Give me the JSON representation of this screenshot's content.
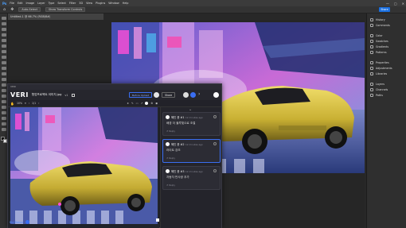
{
  "app": {
    "menus": [
      "File",
      "Edit",
      "Image",
      "Layer",
      "Type",
      "Select",
      "Filter",
      "3D",
      "View",
      "Plugins",
      "Window",
      "Help"
    ],
    "window_controls": [
      "—",
      "▢",
      "✕"
    ],
    "options_chip_1": "Auto-Select",
    "options_chip_2": "Show Transform Controls",
    "share_label": "Share",
    "doc_tab_title": "Untitled-1 @ 66.7% (RGB/8#)"
  },
  "dock": {
    "items": [
      "History",
      "Comments",
      "Color",
      "Swatches",
      "Gradients",
      "Patterns",
      "Properties",
      "Adjustments",
      "Libraries",
      "Layers",
      "Channels",
      "Paths"
    ]
  },
  "veri": {
    "window_title": "VERI",
    "logo": "VERI",
    "file_name": "협업프로젝트 이미지.jpg",
    "version": "v1",
    "before_button": "Before Upload",
    "share_button": "Share",
    "zoom": "10%",
    "page": "1/1",
    "big_button": "Big Bonus"
  },
  "comments": [
    {
      "name": "혜인 윤 #1",
      "time": "12 minutes ago",
      "text": "배경 더 블루빛으로 조절",
      "reply": "Reply"
    },
    {
      "name": "혜인 윤 #2",
      "time": "12 minutes ago",
      "text": "라이트 강조",
      "reply": "Reply"
    },
    {
      "name": "혜인 윤 #3",
      "time": "12 minutes ago",
      "text": "자동차 반사광 추가",
      "reply": "Reply"
    }
  ],
  "colors": {
    "accent": "#3a6ef2",
    "ps_share": "#1a6fe0",
    "car_yellow": "#c9b033",
    "neon_pink": "#ff4fd8"
  }
}
